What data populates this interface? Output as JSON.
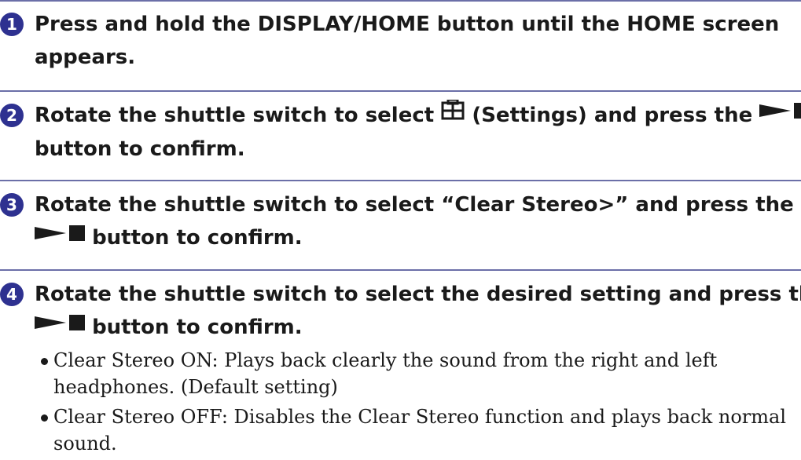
{
  "steps": [
    {
      "number": "1",
      "line1": "Press and hold the DISPLAY/HOME button until the HOME screen",
      "line2": "appears."
    },
    {
      "number": "2",
      "line1_a": "Rotate the shuttle switch to select",
      "settings_icon": "settings-icon",
      "line1_b": "(Settings) and press the",
      "play_stop_icon": "play-stop-icon",
      "line2": "button to confirm."
    },
    {
      "number": "3",
      "line1": "Rotate the shuttle switch to select “Clear Stereo>” and press the",
      "play_stop_icon": "play-stop-icon",
      "line2": "button to confirm."
    },
    {
      "number": "4",
      "line1": "Rotate the shuttle switch to select the desired setting and press the",
      "play_stop_icon": "play-stop-icon",
      "line2": "button to confirm.",
      "options": [
        "Clear Stereo ON: Plays back clearly the sound from the right and left headphones. (Default setting)",
        "Clear Stereo OFF: Disables the Clear Stereo function and plays back normal sound."
      ]
    }
  ],
  "colors": {
    "accent": "#2e3190",
    "rule": "#6b6fa8",
    "text": "#1a1a1a"
  }
}
